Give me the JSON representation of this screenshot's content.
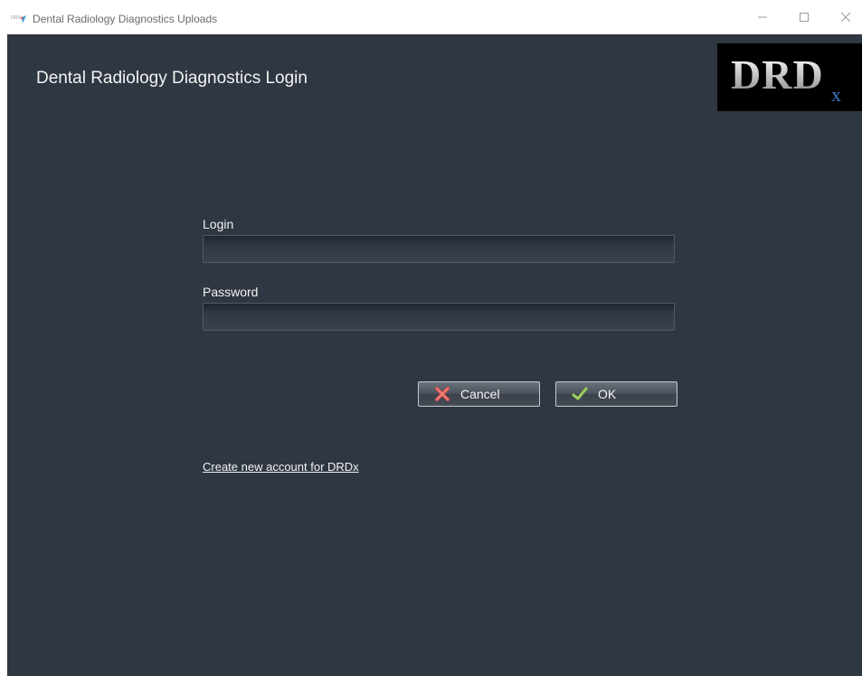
{
  "window": {
    "title": "Dental Radiology Diagnostics Uploads",
    "app_icon": "drd-app-icon",
    "controls": {
      "minimize_icon": "minimize-icon",
      "maximize_icon": "maximize-icon",
      "close_icon": "close-icon"
    }
  },
  "main": {
    "heading": "Dental Radiology Diagnostics Login",
    "logo": {
      "text": "DRD",
      "subscript": "x"
    },
    "login_label": "Login",
    "login_value": "",
    "password_label": "Password",
    "password_value": "",
    "cancel_label": "Cancel",
    "cancel_icon": "x-icon",
    "ok_label": "OK",
    "ok_icon": "checkmark-icon",
    "create_account_link": "Create new account for DRDx"
  },
  "colors": {
    "background": "#2f3743",
    "text": "#f2f2f2",
    "logo_background": "#000000",
    "logo_subscript": "#3b78c7",
    "cancel_icon": "#d9534f",
    "ok_icon": "#7fb24a"
  }
}
